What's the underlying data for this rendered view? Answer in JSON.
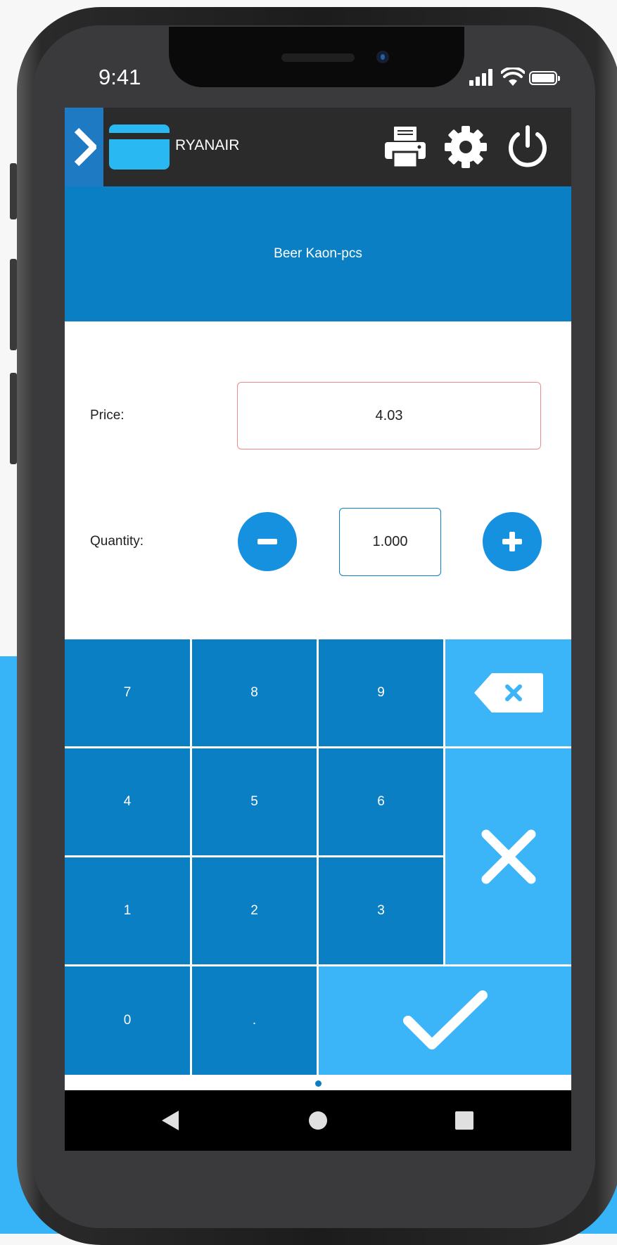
{
  "status_bar": {
    "time": "9:41",
    "icons": [
      "signal-icon",
      "wifi-icon",
      "battery-icon"
    ]
  },
  "topbar": {
    "app_name": "RYANAIR",
    "icons": [
      "chevron-right-icon",
      "card-icon",
      "printer-icon",
      "gear-icon",
      "power-icon"
    ]
  },
  "product": {
    "title": "Beer Kaon-pcs"
  },
  "form": {
    "price_label": "Price:",
    "price_value": "4.03",
    "quantity_label": "Quantity:",
    "quantity_value": "1.000"
  },
  "keypad": {
    "keys": [
      "7",
      "8",
      "9",
      "4",
      "5",
      "6",
      "1",
      "2",
      "3",
      "0",
      "."
    ],
    "action_icons": [
      "backspace-icon",
      "close-icon",
      "checkmark-icon"
    ]
  },
  "android_nav": {
    "icons": [
      "back-icon",
      "home-icon",
      "recents-icon"
    ]
  },
  "colors": {
    "primary": "#0a7fc4",
    "accent": "#3bb5f8",
    "button_blue": "#1691e0",
    "error_border": "#f08a8a",
    "topbar": "#2b2b2b"
  }
}
